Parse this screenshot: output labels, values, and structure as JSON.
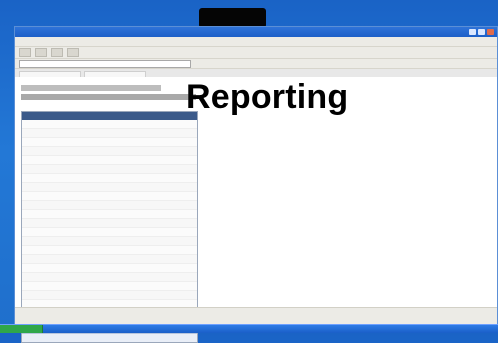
{
  "overlay": {
    "title": "Reporting"
  }
}
